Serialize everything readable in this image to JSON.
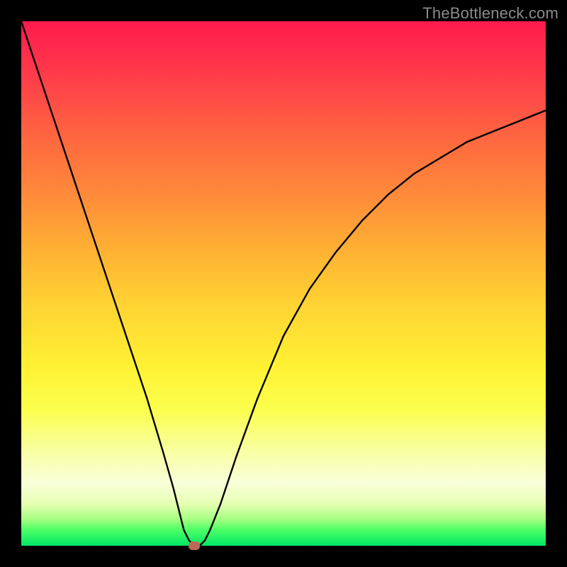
{
  "watermark": "TheBottleneck.com",
  "chart_data": {
    "type": "line",
    "title": "",
    "xlabel": "",
    "ylabel": "",
    "xlim": [
      0,
      100
    ],
    "ylim": [
      0,
      100
    ],
    "grid": false,
    "legend": false,
    "annotations": [],
    "marker": {
      "x": 33,
      "y": 0
    },
    "series": [
      {
        "name": "curve",
        "x": [
          0,
          3,
          6,
          9,
          12,
          15,
          18,
          21,
          24,
          27,
          29,
          30,
          31,
          32,
          33,
          34,
          35,
          36,
          38,
          41,
          45,
          50,
          55,
          60,
          65,
          70,
          75,
          80,
          85,
          90,
          95,
          100
        ],
        "y": [
          100,
          91,
          82,
          73,
          64,
          55,
          46,
          37,
          28,
          18,
          11,
          7,
          3,
          1,
          0,
          0,
          1,
          3,
          8,
          17,
          28,
          40,
          49,
          56,
          62,
          67,
          71,
          74,
          77,
          79,
          81,
          83
        ]
      }
    ],
    "background_gradient": {
      "direction": "vertical",
      "stops": [
        {
          "pos": 0.0,
          "color": "#ff1a4d"
        },
        {
          "pos": 0.55,
          "color": "#ffd633"
        },
        {
          "pos": 0.85,
          "color": "#f8ffc0"
        },
        {
          "pos": 1.0,
          "color": "#00e666"
        }
      ]
    }
  }
}
